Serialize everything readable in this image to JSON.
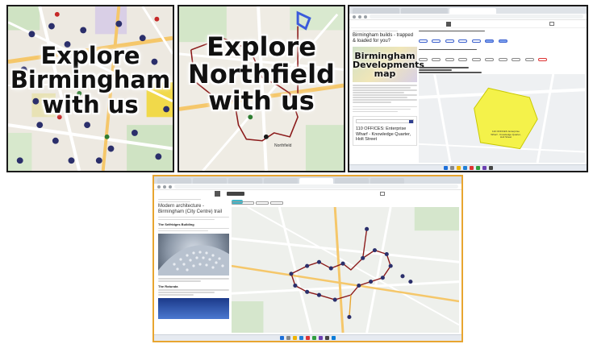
{
  "panel_top_left": {
    "title_lines": [
      "Explore",
      "Birmingham",
      "with us"
    ]
  },
  "panel_top_middle": {
    "title_lines": [
      "Explore",
      "Northfield",
      "with us"
    ],
    "place_label": "Northfield"
  },
  "panel_top_right": {
    "page_heading": "Birmingham builds - trapped & loaded for you?",
    "thumb_title_lines": [
      "Birmingham",
      "Developments",
      "map"
    ],
    "card_title": "110 OFFICES: Enterprise Wharf - Knowledge Quarter, Holt Street",
    "map_label": "110 OFFICES: Enterprise Wharf - Knowledge Quarter, Holt Street"
  },
  "panel_bottom": {
    "page_title": "Modern architecture - Birmingham (City Centre) trail",
    "section_1": "The Selfridges Building",
    "section_2": "The Rotunda"
  },
  "colors": {
    "frame_black": "#1a1a1a",
    "frame_orange": "#e8a530",
    "route_red": "#8b1a1a",
    "pin_navy": "#2b2f6b",
    "teal_button": "#3fb6c8",
    "yellow_area": "#f4f24a"
  }
}
